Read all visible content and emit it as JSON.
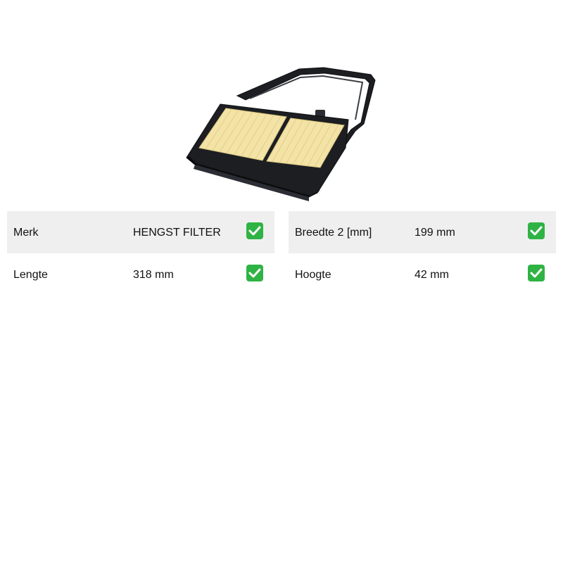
{
  "product": {
    "image_icon": "air-filter-product-image"
  },
  "specs": {
    "left": [
      {
        "label": "Merk",
        "value": "HENGST FILTER",
        "status_icon": "check-icon"
      },
      {
        "label": "Lengte",
        "value": "318 mm",
        "status_icon": "check-icon"
      }
    ],
    "right": [
      {
        "label": "Breedte 2 [mm]",
        "value": "199 mm",
        "status_icon": "check-icon"
      },
      {
        "label": "Hoogte",
        "value": "42 mm",
        "status_icon": "check-icon"
      }
    ]
  },
  "colors": {
    "row_shade": "#efefef",
    "check_green": "#2fb344",
    "filter_frame": "#1c1e22",
    "filter_media": "#f3e3a6"
  }
}
